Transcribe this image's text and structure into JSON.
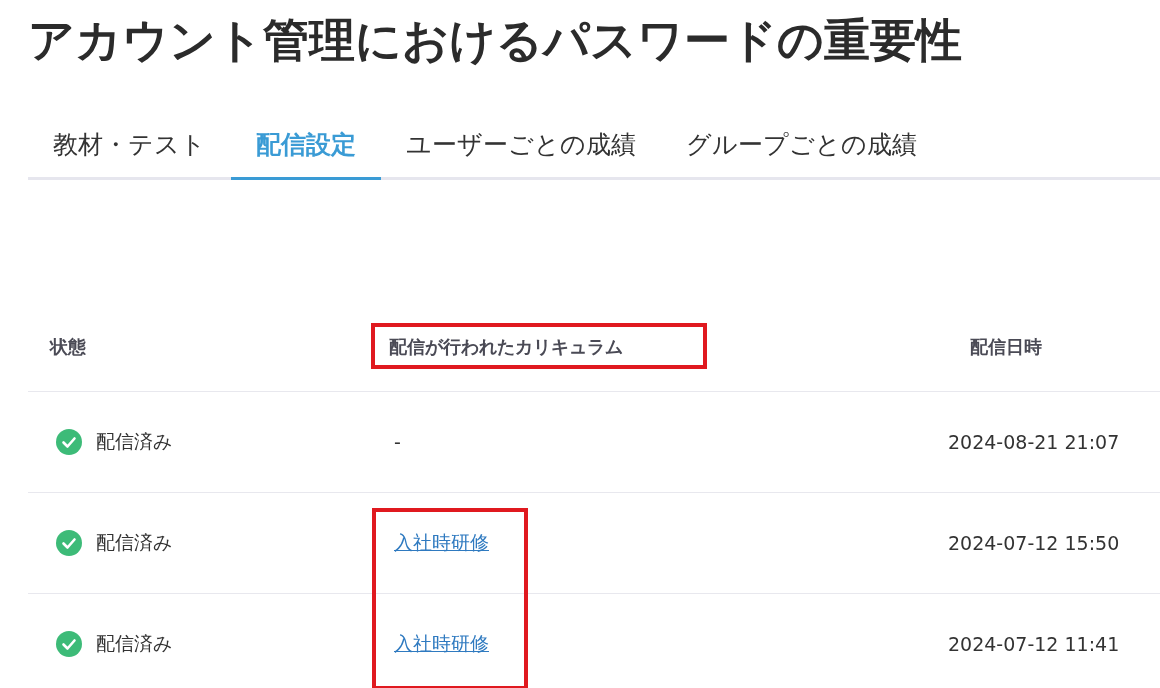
{
  "title": "アカウント管理におけるパスワードの重要性",
  "tabs": [
    {
      "label": "教材・テスト",
      "selected": false
    },
    {
      "label": "配信設定",
      "selected": true
    },
    {
      "label": "ユーザーごとの成績",
      "selected": false
    },
    {
      "label": "グループごとの成績",
      "selected": false
    }
  ],
  "table": {
    "columns": [
      {
        "label": "状態",
        "highlighted": false
      },
      {
        "label": "配信が行われたカリキュラム",
        "highlighted": true
      },
      {
        "label": "配信日時",
        "highlighted": false
      }
    ],
    "rows": [
      {
        "status": "配信済み",
        "curriculum": "-",
        "kind": "text",
        "date": "2024-08-21 21:07",
        "highlighted": false
      },
      {
        "status": "配信済み",
        "curriculum": "入社時研修",
        "kind": "link",
        "date": "2024-07-12 15:50",
        "highlighted": true
      },
      {
        "status": "配信済み",
        "curriculum": "入社時研修",
        "kind": "link",
        "date": "2024-07-12 11:41",
        "highlighted": true
      }
    ]
  }
}
